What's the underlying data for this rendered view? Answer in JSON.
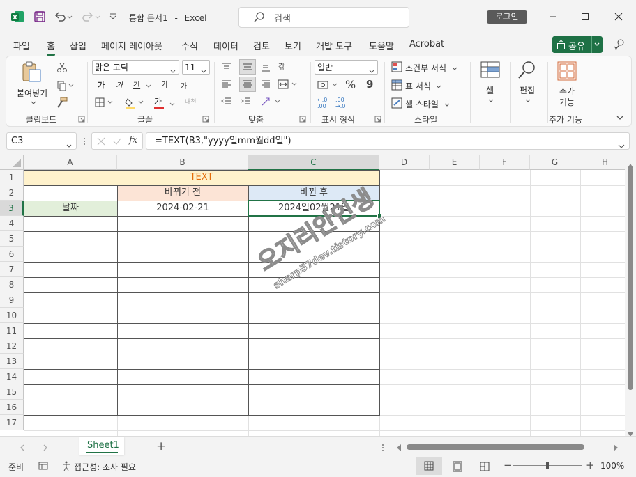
{
  "titlebar": {
    "doc_title": "통합 문서1",
    "app_name": "Excel",
    "separator": "-",
    "search_placeholder": "검색",
    "login": "로그인"
  },
  "tabs": [
    "파일",
    "홈",
    "삽입",
    "페이지 레이아웃",
    "수식",
    "데이터",
    "검토",
    "보기",
    "개발 도구",
    "도움말",
    "Acrobat"
  ],
  "active_tab": "홈",
  "share": "공유",
  "ribbon": {
    "clipboard": {
      "label": "클립보드",
      "paste": "붙여넣기"
    },
    "font": {
      "label": "글꼴",
      "name": "맑은 고딕",
      "size": "11",
      "bold": "가",
      "italic": "가",
      "underline": "간",
      "grow": "가",
      "shrink": "가",
      "font_color_glyph": "가",
      "phonetic": "내천"
    },
    "alignment": {
      "label": "맞춤",
      "wrap": "갂"
    },
    "number": {
      "label": "표시 형식",
      "format": "일반",
      "percent": "%",
      "comma": "9",
      "dec_inc": "←.0 .00",
      "dec_dec": ".00 →.0"
    },
    "styles": {
      "label": "스타일",
      "cond_format": "조건부 서식",
      "table_format": "표 서식",
      "cell_styles": "셀 스타일"
    },
    "cells": {
      "label": "셀"
    },
    "editing": {
      "label": "편집"
    },
    "addins": {
      "label": "추가 기능",
      "btn_line1": "추가",
      "btn_line2": "기능"
    }
  },
  "formula_bar": {
    "name_box": "C3",
    "fx": "fx",
    "formula": "=TEXT(B3,\"yyyy일mm월dd일\")"
  },
  "sheet": {
    "columns": [
      "A",
      "B",
      "C",
      "D",
      "E",
      "F",
      "G",
      "H"
    ],
    "rows": [
      "1",
      "2",
      "3",
      "4",
      "5",
      "6",
      "7",
      "8",
      "9",
      "10",
      "11",
      "12",
      "13",
      "14",
      "15",
      "16",
      "17"
    ],
    "selected_col": "C",
    "selected_row": "3",
    "cells": {
      "title": "TEXT",
      "before_header": "바뀌기 전",
      "after_header": "바뀐 후",
      "date_label": "날짜",
      "before_value": "2024-02-21",
      "after_value": "2024일02월21일"
    },
    "colors": {
      "title_fill": "#fff2cc",
      "title_text": "#e46c0a",
      "before_fill": "#fce4d6",
      "after_fill": "#dde9f6",
      "date_fill": "#e2efda",
      "accent": "#217346"
    }
  },
  "watermark": {
    "line1": "오지리안인생",
    "line2": "sharp57dev.tistory.com"
  },
  "sheet_tabs": {
    "active": "Sheet1",
    "add": "+"
  },
  "status": {
    "ready": "준비",
    "accessibility": "접근성: 조사 필요",
    "zoom": "100%"
  }
}
